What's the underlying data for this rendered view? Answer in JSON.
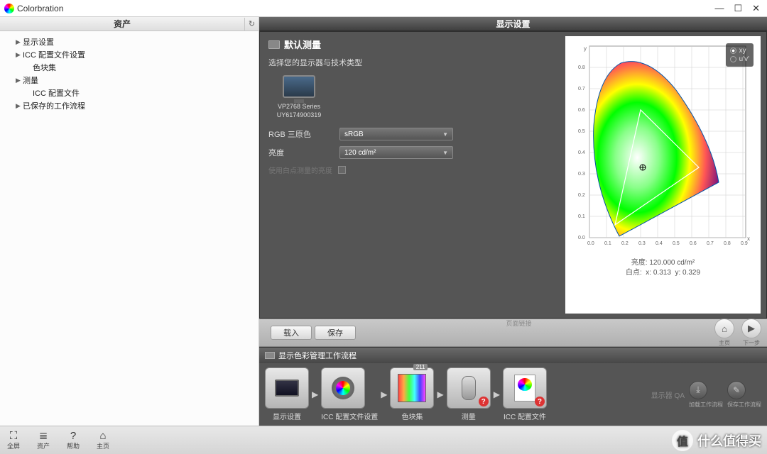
{
  "window": {
    "title": "Colorbration",
    "min": "—",
    "max": "☐",
    "close": "✕"
  },
  "left": {
    "header": "资产",
    "items": [
      {
        "label": "显示设置",
        "arrow": "▶"
      },
      {
        "label": "ICC 配置文件设置",
        "arrow": "▶"
      },
      {
        "label": "色块集",
        "child": true
      },
      {
        "label": "测量",
        "arrow": "▶"
      },
      {
        "label": "ICC 配置文件",
        "child": true
      },
      {
        "label": "已保存的工作流程",
        "arrow": "▶"
      }
    ]
  },
  "right": {
    "header": "显示设置",
    "section_title": "默认测量",
    "subtitle": "选择您的显示器与技术类型",
    "monitor_name": "VP2768 Series",
    "monitor_serial": "UY6174900319",
    "row1_label": "RGB 三原色",
    "row1_value": "sRGB",
    "row2_label": "亮度",
    "row2_value": "120 cd/m²",
    "disabled_text": "使用白点测量的亮度"
  },
  "chart_data": {
    "type": "area",
    "title": "CIE 1931 xy",
    "xlabel": "x",
    "ylabel": "y",
    "xlim": [
      0.0,
      0.9
    ],
    "ylim": [
      0.0,
      0.9
    ],
    "ticks": [
      0.0,
      0.1,
      0.2,
      0.3,
      0.4,
      0.5,
      0.6,
      0.7,
      0.8,
      0.9
    ],
    "spectral_locus": [
      [
        0.175,
        0.005
      ],
      [
        0.14,
        0.03
      ],
      [
        0.1,
        0.11
      ],
      [
        0.065,
        0.2
      ],
      [
        0.025,
        0.38
      ],
      [
        0.01,
        0.54
      ],
      [
        0.045,
        0.68
      ],
      [
        0.1,
        0.79
      ],
      [
        0.15,
        0.82
      ],
      [
        0.21,
        0.775
      ],
      [
        0.29,
        0.7
      ],
      [
        0.39,
        0.595
      ],
      [
        0.5,
        0.48
      ],
      [
        0.6,
        0.39
      ],
      [
        0.68,
        0.315
      ],
      [
        0.735,
        0.265
      ],
      [
        0.175,
        0.005
      ]
    ],
    "gamut_triangle": {
      "name": "sRGB",
      "r": [
        0.64,
        0.33
      ],
      "g": [
        0.3,
        0.6
      ],
      "b": [
        0.15,
        0.06
      ]
    },
    "white_point": {
      "x": 0.313,
      "y": 0.329
    },
    "radios": {
      "xy": "xy",
      "uv": "u'v'"
    },
    "info_luminance_label": "亮度:",
    "info_luminance_value": "120.000 cd/m²",
    "info_white_label": "白点:",
    "info_white_x": "x: 0.313",
    "info_white_y": "y: 0.329"
  },
  "btns": {
    "hint": "页面链接",
    "load": "载入",
    "save": "保存",
    "home": "主页",
    "next": "下一步",
    "home_icon": "⌂",
    "next_icon": "▶"
  },
  "workflow": {
    "header": "显示色彩管理工作流程",
    "items": [
      {
        "name": "显示设置"
      },
      {
        "name": "ICC 配置文件设置"
      },
      {
        "name": "色块集",
        "badge": "211"
      },
      {
        "name": "测量",
        "err": true
      },
      {
        "name": "ICC 配置文件",
        "err": true
      }
    ],
    "arrow": "▶",
    "qa": "显示器 QA",
    "right1": "加载工作流程",
    "right2": "保存工作流程"
  },
  "bottom": [
    {
      "icon": "⛶",
      "label": "全屏"
    },
    {
      "icon": "≣",
      "label": "资产"
    },
    {
      "icon": "?",
      "label": "帮助"
    },
    {
      "icon": "⌂",
      "label": "主页"
    }
  ],
  "watermark": "什么值得买"
}
